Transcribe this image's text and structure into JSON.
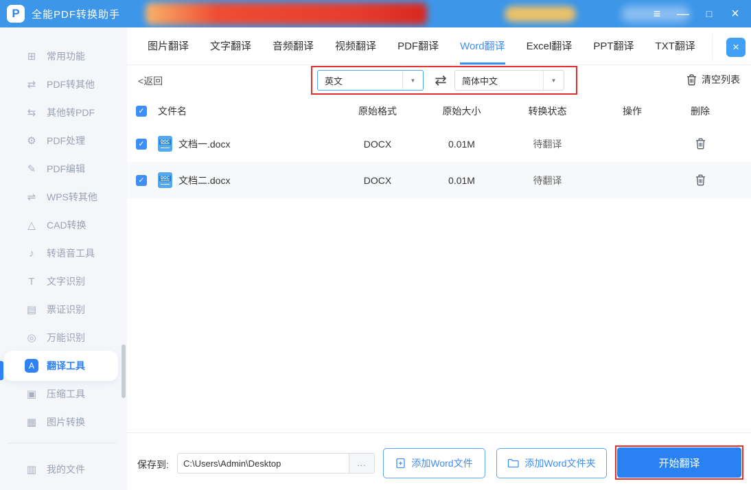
{
  "window": {
    "title": "全能PDF转换助手",
    "logo_letter": "P",
    "controls": {
      "menu": "≡",
      "minimize": "—",
      "maximize": "□",
      "close": "×"
    }
  },
  "icons": {
    "check": "✓",
    "dropdown": "▼",
    "swap": "⇄",
    "close_tab": "×"
  },
  "tabs": {
    "items": [
      "图片翻译",
      "文字翻译",
      "音频翻译",
      "视频翻译",
      "PDF翻译",
      "Word翻译",
      "Excel翻译",
      "PPT翻译",
      "TXT翻译"
    ],
    "active": "Word翻译"
  },
  "toolbar": {
    "back": "<返回",
    "source_language": "英文",
    "target_language": "简体中文",
    "clear_list": "清空列表"
  },
  "table": {
    "headers": {
      "name": "文件名",
      "format": "原始格式",
      "size": "原始大小",
      "status": "转换状态",
      "action": "操作",
      "delete": "删除"
    },
    "rows": [
      {
        "doc_badge": "DOC",
        "name": "文档一.docx",
        "format": "DOCX",
        "size": "0.01M",
        "status": "待翻译"
      },
      {
        "doc_badge": "DOC",
        "name": "文档二.docx",
        "format": "DOCX",
        "size": "0.01M",
        "status": "待翻译"
      }
    ]
  },
  "sidebar": {
    "items": [
      {
        "label": "常用功能",
        "glyph": "⊞"
      },
      {
        "label": "PDF转其他",
        "glyph": "⇄"
      },
      {
        "label": "其他转PDF",
        "glyph": "⇆"
      },
      {
        "label": "PDF处理",
        "glyph": "⚙"
      },
      {
        "label": "PDF编辑",
        "glyph": "✎"
      },
      {
        "label": "WPS转其他",
        "glyph": "⇌"
      },
      {
        "label": "CAD转换",
        "glyph": "△"
      },
      {
        "label": "转语音工具",
        "glyph": "♪"
      },
      {
        "label": "文字识别",
        "glyph": "T"
      },
      {
        "label": "票证识别",
        "glyph": "▤"
      },
      {
        "label": "万能识别",
        "glyph": "◎"
      },
      {
        "label": "翻译工具",
        "glyph": "A"
      },
      {
        "label": "压缩工具",
        "glyph": "▣"
      },
      {
        "label": "图片转换",
        "glyph": "▦"
      },
      {
        "label": "我的文件",
        "glyph": "▥"
      }
    ],
    "active": "翻译工具"
  },
  "footer": {
    "save_label": "保存到:",
    "save_path": "C:\\Users\\Admin\\Desktop",
    "browse": "...",
    "add_file": "添加Word文件",
    "add_folder": "添加Word文件夹",
    "start": "开始翻译"
  },
  "colors": {
    "titlebar": "#3D96E8",
    "accent": "#2F82F5",
    "annotation": "#E3302E"
  }
}
